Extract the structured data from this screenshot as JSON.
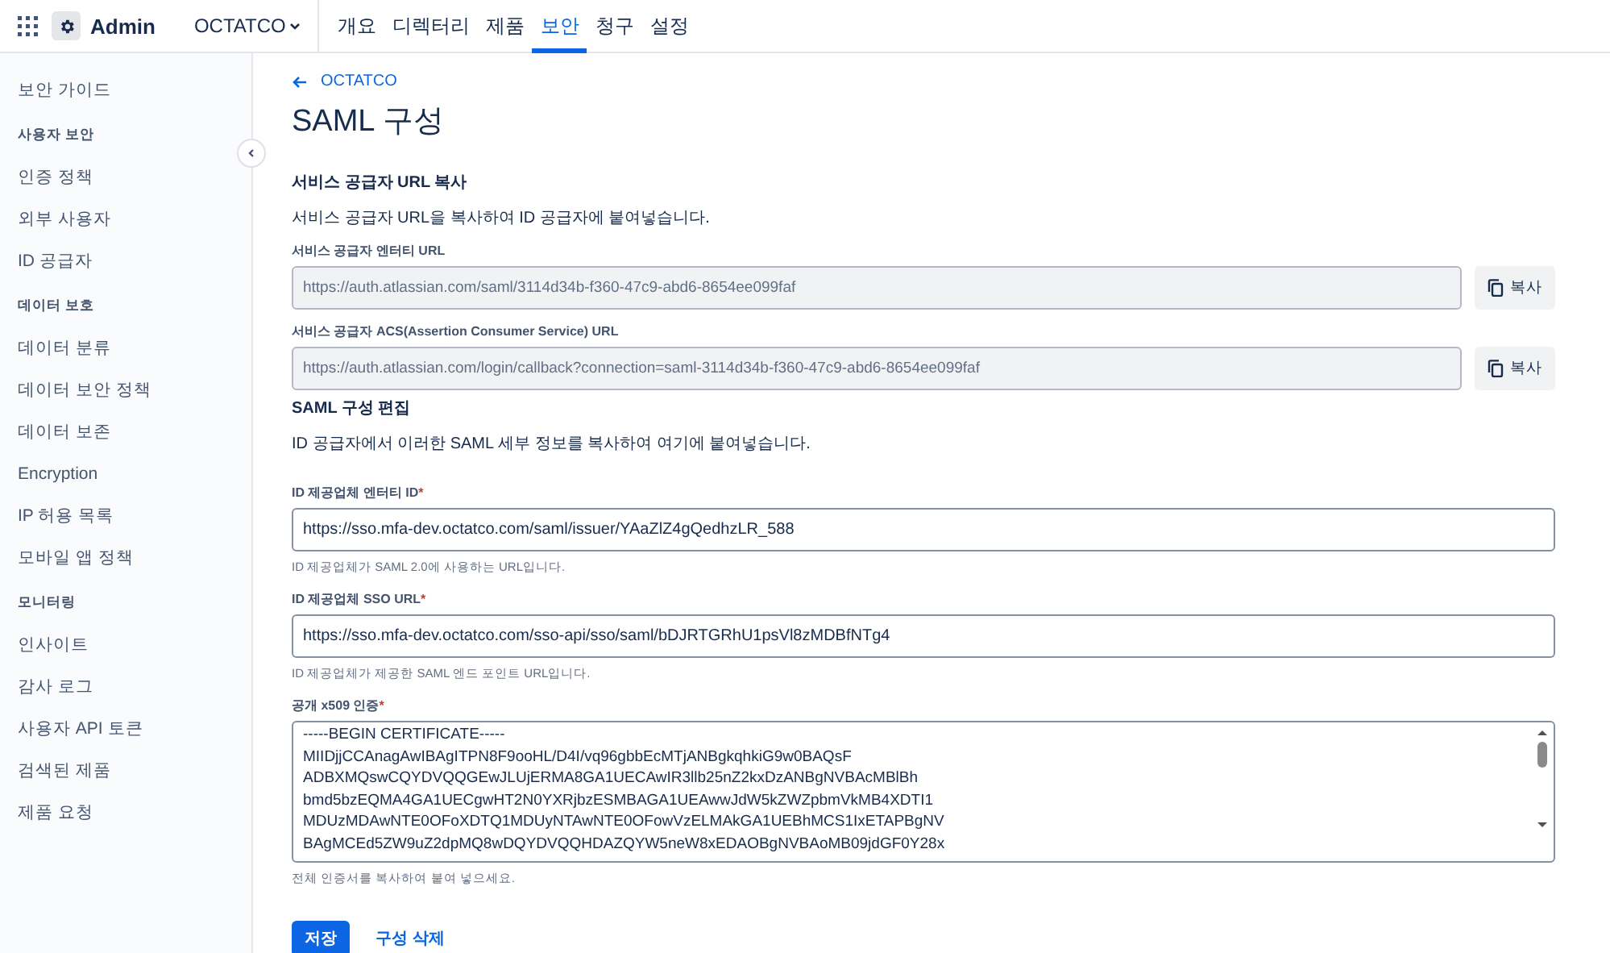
{
  "topbar": {
    "app_name": "Admin",
    "org": "OCTATCO",
    "tabs": [
      {
        "label": "개요",
        "selected": false
      },
      {
        "label": "디렉터리",
        "selected": false
      },
      {
        "label": "제품",
        "selected": false
      },
      {
        "label": "보안",
        "selected": true
      },
      {
        "label": "청구",
        "selected": false
      },
      {
        "label": "설정",
        "selected": false
      }
    ]
  },
  "sidebar": {
    "items": [
      {
        "kind": "item",
        "label": "보안 가이드"
      },
      {
        "kind": "header",
        "label": "사용자 보안"
      },
      {
        "kind": "item",
        "label": "인증 정책"
      },
      {
        "kind": "item",
        "label": "외부 사용자"
      },
      {
        "kind": "item",
        "label": "ID 공급자"
      },
      {
        "kind": "header",
        "label": "데이터 보호"
      },
      {
        "kind": "item",
        "label": "데이터 분류"
      },
      {
        "kind": "item",
        "label": "데이터 보안 정책"
      },
      {
        "kind": "item",
        "label": "데이터 보존"
      },
      {
        "kind": "item",
        "label": "Encryption"
      },
      {
        "kind": "item",
        "label": "IP 허용 목록"
      },
      {
        "kind": "item",
        "label": "모바일 앱 정책"
      },
      {
        "kind": "header",
        "label": "모니터링"
      },
      {
        "kind": "item",
        "label": "인사이트"
      },
      {
        "kind": "item",
        "label": "감사 로그"
      },
      {
        "kind": "item",
        "label": "사용자 API 토큰"
      },
      {
        "kind": "item",
        "label": "검색된 제품"
      },
      {
        "kind": "item",
        "label": "제품 요청"
      }
    ]
  },
  "page": {
    "back_link": "OCTATCO",
    "title": "SAML 구성",
    "sp_section": {
      "heading": "서비스 공급자 URL 복사",
      "description": "서비스 공급자 URL을 복사하여 ID 공급자에 붙여넣습니다.",
      "fields": [
        {
          "label": "서비스 공급자 엔터티 URL",
          "value": "https://auth.atlassian.com/saml/3114d34b-f360-47c9-abd6-8654ee099faf",
          "copy_label": "복사"
        },
        {
          "label": "서비스 공급자 ACS(Assertion Consumer Service) URL",
          "value": "https://auth.atlassian.com/login/callback?connection=saml-3114d34b-f360-47c9-abd6-8654ee099faf",
          "copy_label": "복사"
        }
      ]
    },
    "edit_section": {
      "heading": "SAML 구성 편집",
      "description": "ID 공급자에서 이러한 SAML 세부 정보를 복사하여 여기에 붙여넣습니다.",
      "fields": [
        {
          "kind": "input",
          "label": "ID 제공업체 엔터티 ID",
          "required_mark": "*",
          "value": "https://sso.mfa-dev.octatco.com/saml/issuer/YAaZlZ4gQedhzLR_588",
          "help": "ID 제공업체가 SAML 2.0에 사용하는 URL입니다."
        },
        {
          "kind": "input",
          "label": "ID 제공업체 SSO URL",
          "required_mark": "*",
          "value": "https://sso.mfa-dev.octatco.com/sso-api/sso/saml/bDJRTGRhU1psVl8zMDBfNTg4",
          "help": "ID 제공업체가 제공한 SAML 엔드 포인트 URL입니다."
        },
        {
          "kind": "textarea",
          "label": "공개 x509 인증",
          "required_mark": "*",
          "value": "-----BEGIN CERTIFICATE-----\nMIIDjjCCAnagAwIBAgITPN8F9ooHL/D4I/vq96gbbEcMTjANBgkqhkiG9w0BAQsF\nADBXMQswCQYDVQQGEwJLUjERMA8GA1UECAwIR3llb25nZ2kxDzANBgNVBAcMBlBh\nbmd5bzEQMA4GA1UECgwHT2N0YXRjbzESMBAGA1UEAwwJdW5kZWZpbmVkMB4XDTI1\nMDUzMDAwNTE0OFoXDTQ1MDUyNTAwNTE0OFowVzELMAkGA1UEBhMCS1IxETAPBgNV\nBAgMCEd5ZW9uZ2dpMQ8wDQYDVQQHDAZQYW5neW8xEDAOBgNVBAoMB09jdGF0Y28x",
          "help": "전체 인증서를 복사하여 붙여 넣으세요."
        }
      ]
    },
    "buttons": [
      {
        "kind": "primary",
        "label": "저장"
      },
      {
        "kind": "link",
        "label": "구성 삭제"
      }
    ]
  }
}
